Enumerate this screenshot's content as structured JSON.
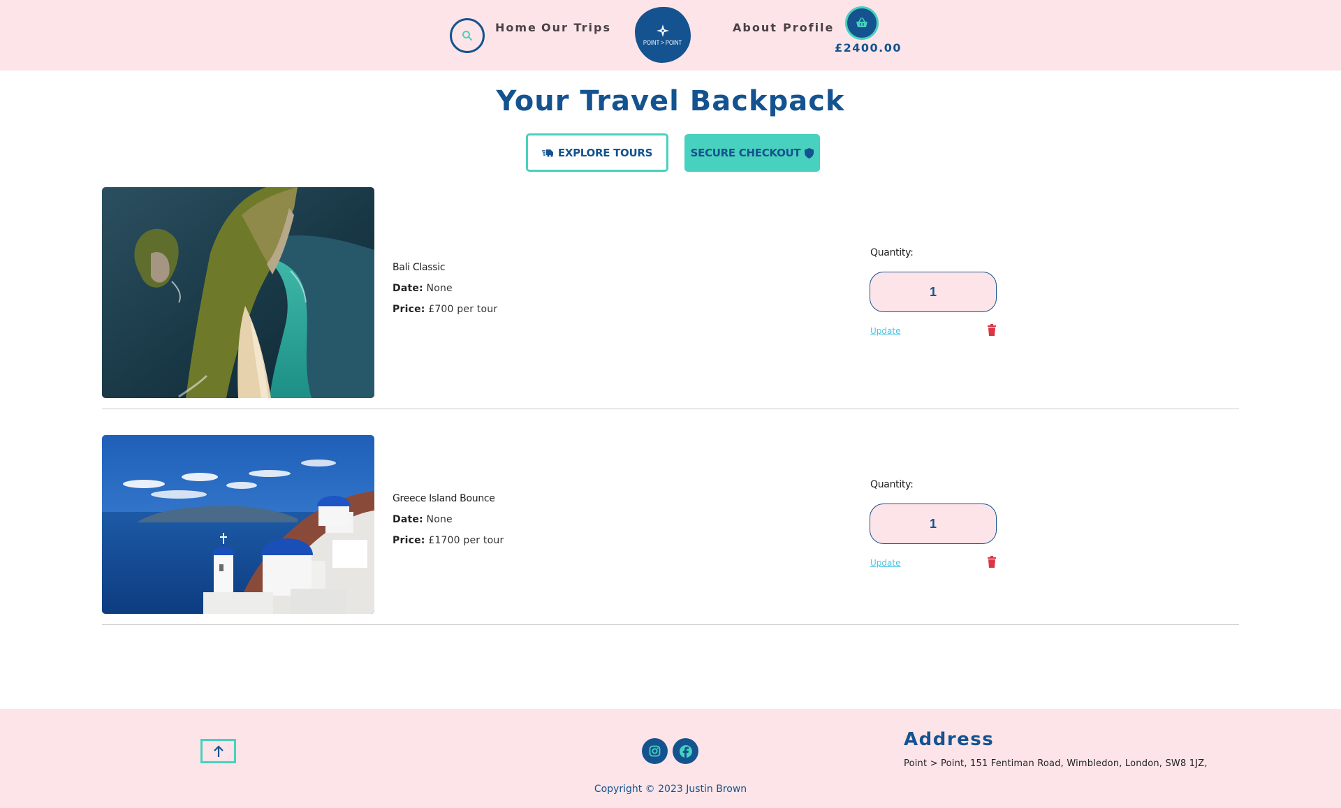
{
  "header": {
    "nav_left": [
      "Home",
      "Our Trips"
    ],
    "nav_right": [
      "About",
      "Profile"
    ],
    "logo_text": "POINT > POINT",
    "cart_total": "£2400.00",
    "icons": {
      "search": "search-icon",
      "cart": "basket-icon",
      "logo": "compass-icon"
    }
  },
  "main": {
    "title": "Your Travel Backpack",
    "explore_label": "EXPLORE TOURS",
    "checkout_label": "SECURE CHECKOUT"
  },
  "items": [
    {
      "name": "Bali Classic",
      "date_label": "Date:",
      "date_value": "None",
      "price_label": "Price:",
      "price_value": "£700 per tour",
      "quantity_label": "Quantity:",
      "quantity": "1",
      "update_label": "Update"
    },
    {
      "name": "Greece Island Bounce",
      "date_label": "Date:",
      "date_value": "None",
      "price_label": "Price:",
      "price_value": "£1700 per tour",
      "quantity_label": "Quantity:",
      "quantity": "1",
      "update_label": "Update"
    }
  ],
  "footer": {
    "copyright": "Copyright © 2023 Justin Brown",
    "address_title": "Address",
    "address_text": "Point > Point, 151 Fentiman Road, Wimbledon, London, SW8 1JZ,",
    "social": [
      "instagram-icon",
      "facebook-icon"
    ]
  },
  "colors": {
    "brand_navy": "#14538f",
    "accent_teal": "#48d1be",
    "pink_bg": "#fde4e8",
    "danger_red": "#dc3545",
    "link_blue": "#48c4e0"
  }
}
